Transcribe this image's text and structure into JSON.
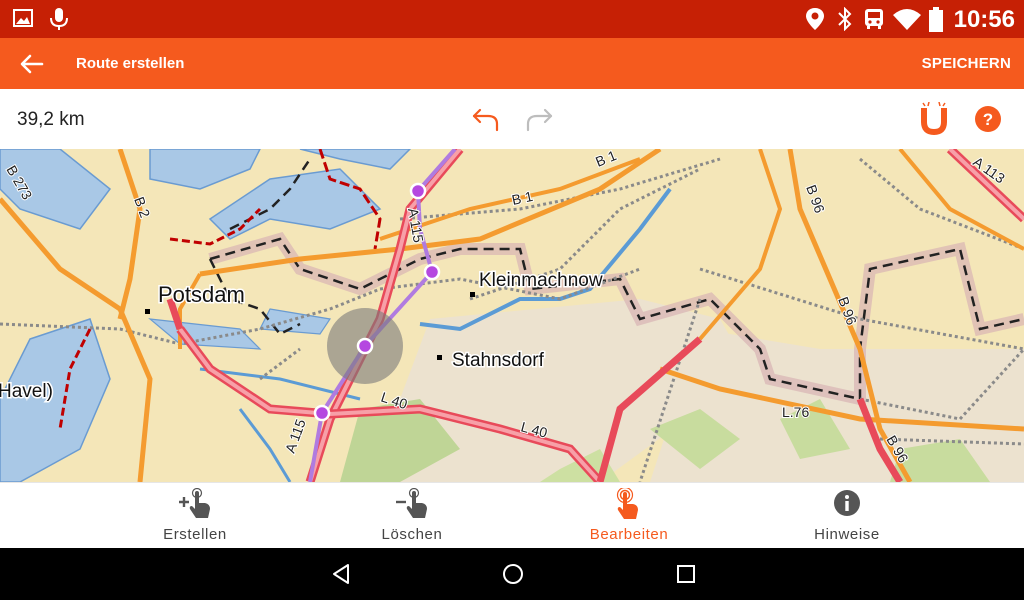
{
  "status_bar": {
    "time": "10:56",
    "left_icons": [
      "image-icon",
      "mic-icon"
    ],
    "right_icons": [
      "location-icon",
      "bluetooth-icon",
      "transit-icon",
      "wifi-icon",
      "battery-icon"
    ]
  },
  "app_bar": {
    "title": "Route erstellen",
    "save_label": "SPEICHERN",
    "color": "#f55a1e",
    "status_color": "#c62005"
  },
  "toolbar": {
    "distance": "39,2 km",
    "undo_icon": "undo-icon",
    "redo_icon": "redo-icon",
    "magnet_icon": "magnet-icon",
    "help_icon": "help-icon"
  },
  "map": {
    "places": [
      "Potsdam",
      "Kleinmachnow",
      "Stahnsdorf",
      "Havel)"
    ],
    "roads": [
      "B 273",
      "B 2",
      "B 1",
      "B 1",
      "A 115",
      "A 115",
      "A 113",
      "B 96",
      "B 96",
      "B 96",
      "L 40",
      "L 40",
      "L.76"
    ]
  },
  "bottom_nav": {
    "items": [
      {
        "label": "Erstellen",
        "icon": "add-touch-icon",
        "active": false
      },
      {
        "label": "Löschen",
        "icon": "remove-touch-icon",
        "active": false
      },
      {
        "label": "Bearbeiten",
        "icon": "edit-touch-icon",
        "active": true
      },
      {
        "label": "Hinweise",
        "icon": "info-icon",
        "active": false
      }
    ]
  },
  "system_nav": [
    "back-icon",
    "home-icon",
    "recents-icon"
  ]
}
